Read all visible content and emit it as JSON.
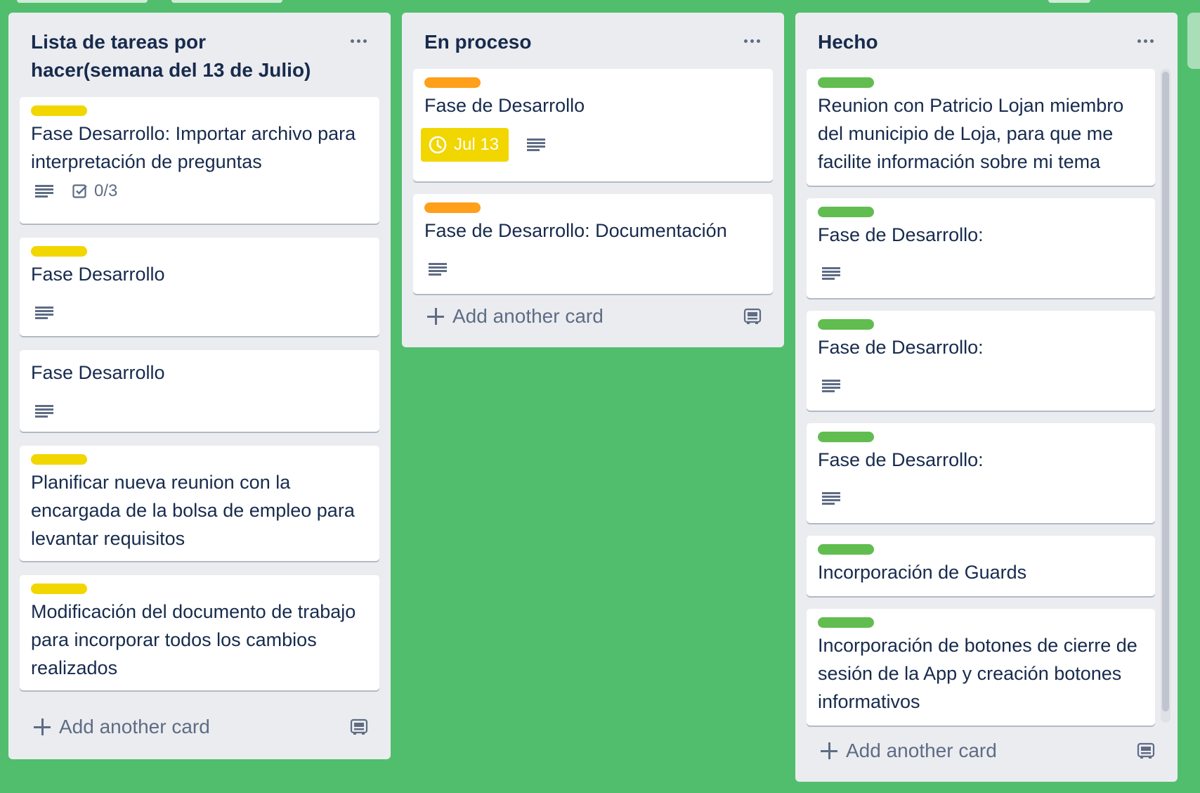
{
  "colors": {
    "board_bg": "#51be6e",
    "label_yellow": "#f2d600",
    "label_orange": "#ff9f1a",
    "label_green": "#61bd4f"
  },
  "icons": {
    "menu": "ellipsis-icon",
    "description": "description-icon",
    "checklist": "checklist-icon",
    "due": "clock-icon",
    "add": "plus-icon",
    "template": "card-template-icon"
  },
  "lists": [
    {
      "title": "Lista de tareas por hacer(semana del 13 de Julio)",
      "add_label": "Add another card",
      "cards": [
        {
          "label": "yellow",
          "title": "Fase Desarrollo: Importar archivo para interpretación de preguntas",
          "has_description": true,
          "checklist": "0/3"
        },
        {
          "label": "yellow",
          "title": "Fase Desarrollo",
          "has_description": true
        },
        {
          "label": "",
          "title": "Fase Desarrollo",
          "has_description": true
        },
        {
          "label": "yellow",
          "title": "Planificar nueva reunion con la encargada de la bolsa de empleo para levantar requisitos"
        },
        {
          "label": "yellow",
          "title": "Modificación del documento de trabajo para incorporar todos los cambios realizados"
        }
      ]
    },
    {
      "title": "En proceso",
      "add_label": "Add another card",
      "cards": [
        {
          "label": "orange",
          "title": "Fase de Desarrollo",
          "due": "Jul 13",
          "has_description": true
        },
        {
          "label": "orange",
          "title": "Fase de Desarrollo: Documentación",
          "has_description": true
        }
      ]
    },
    {
      "title": "Hecho",
      "add_label": "Add another card",
      "cards": [
        {
          "label": "green",
          "title": "Reunion con Patricio Lojan miembro del municipio de Loja, para que me facilite información sobre mi tema"
        },
        {
          "label": "green",
          "title": "Fase de Desarrollo:",
          "has_description": true
        },
        {
          "label": "green",
          "title": "Fase de Desarrollo:",
          "has_description": true
        },
        {
          "label": "green",
          "title": "Fase de Desarrollo:",
          "has_description": true
        },
        {
          "label": "green",
          "title": "Incorporación de Guards"
        },
        {
          "label": "green",
          "title": "Incorporación de botones de cierre de sesión de la App y creación botones informativos"
        }
      ]
    }
  ]
}
